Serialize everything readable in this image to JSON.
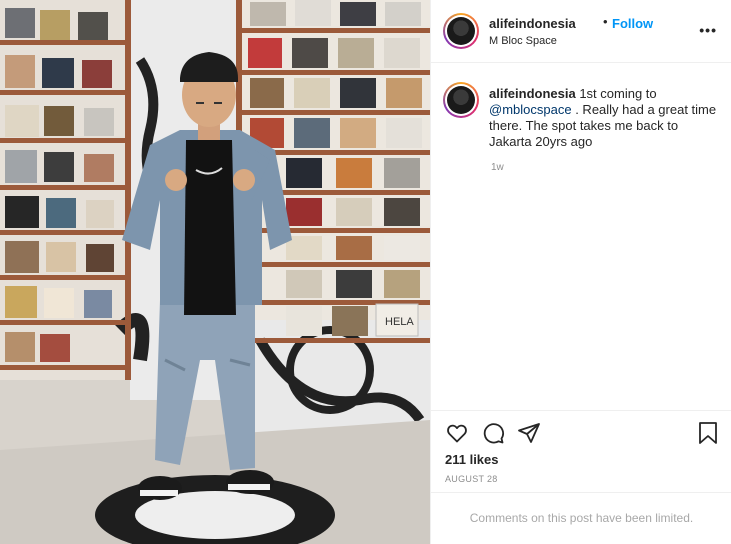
{
  "post": {
    "username": "alifeindonesia",
    "follow_label": "Follow",
    "dot": "•",
    "location": "M Bloc Space",
    "more_label": "•••"
  },
  "comment": {
    "username": "alifeindonesia",
    "text_before": "1st coming to",
    "mention": "@mblocspace",
    "text_after": ". Really had a great time there. The spot takes me back to Jakarta 20yrs ago",
    "time": "1w"
  },
  "stats": {
    "likes": "211 likes",
    "date": "AUGUST 28"
  },
  "footer": {
    "limited_text": "Comments on this post have been limited."
  },
  "icons": [
    "heart-icon",
    "comment-icon",
    "share-icon",
    "bookmark-icon",
    "more-icon"
  ],
  "photo": {
    "record_labels": [
      "HELA"
    ]
  }
}
